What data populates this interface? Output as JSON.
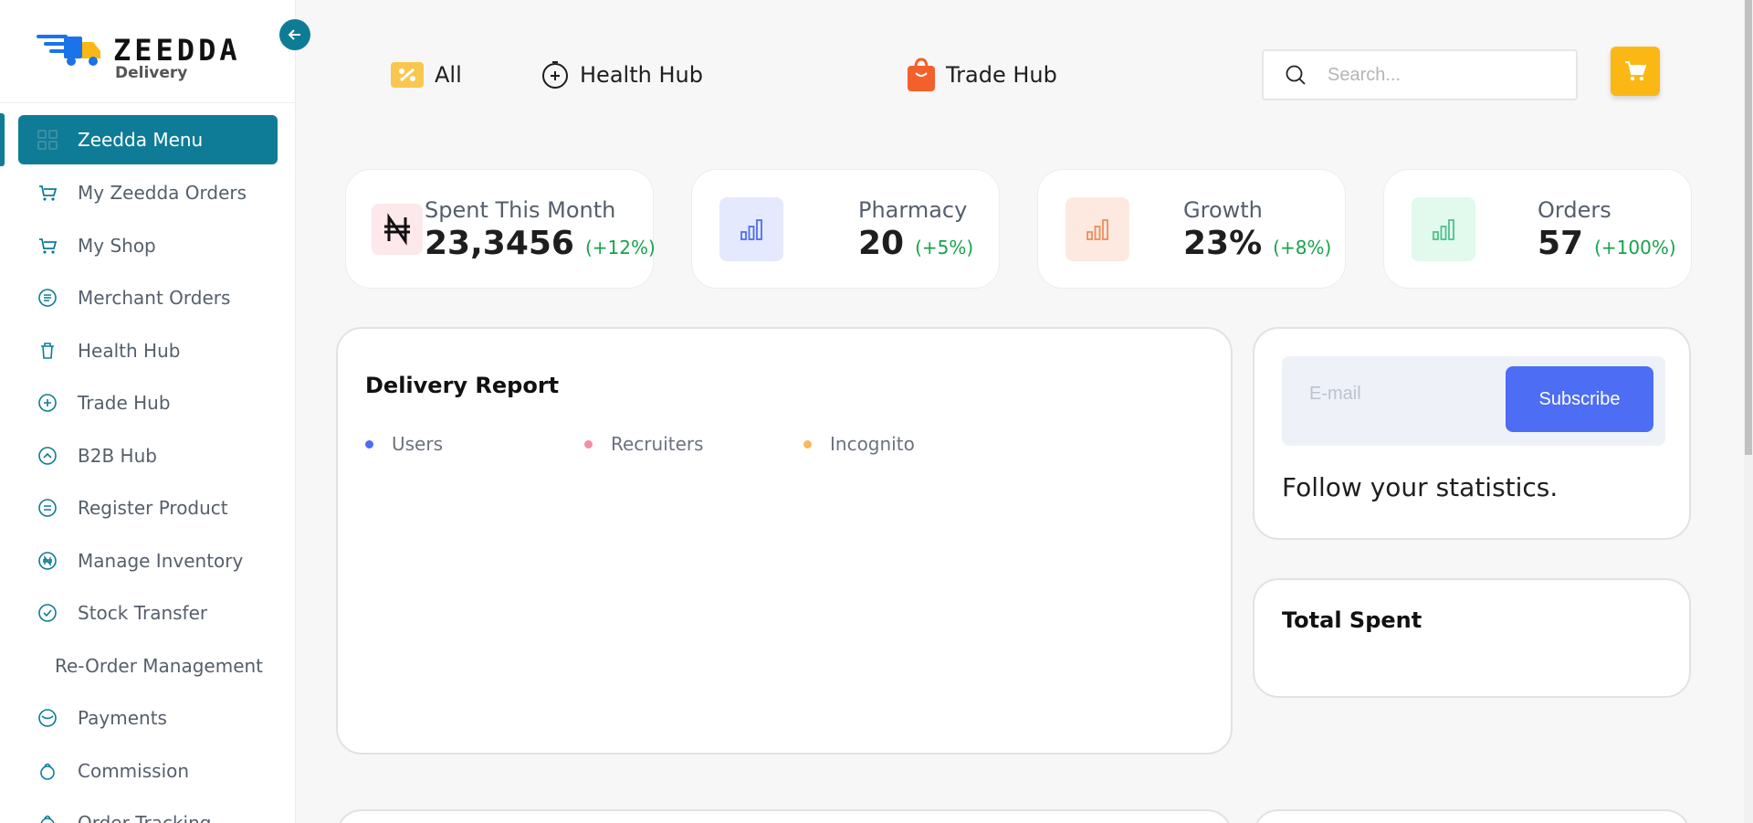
{
  "brand": {
    "name": "ZEEDDA",
    "subtitle": "Delivery"
  },
  "sidebar": {
    "items": [
      {
        "label": "Zeedda Menu",
        "icon": "grid-icon",
        "active": true
      },
      {
        "label": "My Zeedda Orders",
        "icon": "cart-icon"
      },
      {
        "label": "My Shop",
        "icon": "cart-icon"
      },
      {
        "label": "Merchant Orders",
        "icon": "list-circle-icon"
      },
      {
        "label": "Health Hub",
        "icon": "bin-icon"
      },
      {
        "label": "Trade Hub",
        "icon": "plus-circle-icon"
      },
      {
        "label": "B2B Hub",
        "icon": "arrow-up-circle-icon"
      },
      {
        "label": "Register Product",
        "icon": "equals-circle-icon"
      },
      {
        "label": "Manage Inventory",
        "icon": "naira-circle-icon"
      },
      {
        "label": "Stock Transfer",
        "icon": "check-circle-icon"
      },
      {
        "label": "Re-Order Management",
        "icon": ""
      },
      {
        "label": "Payments",
        "icon": "clock-icon"
      },
      {
        "label": "Commission",
        "icon": "bag-icon"
      },
      {
        "label": "Order Tracking",
        "icon": "bag-icon"
      }
    ]
  },
  "topnav": {
    "all": "All",
    "health_hub": "Health Hub",
    "trade_hub": "Trade Hub",
    "search_placeholder": "Search..."
  },
  "stats": [
    {
      "label": "Spent This Month",
      "value": "23,3456",
      "change": "(+12%)",
      "icon": "naira-icon",
      "icon_bg": "#fde8ec"
    },
    {
      "label": "Pharmacy",
      "value": "20",
      "change": "(+5%)",
      "icon": "bar-chart-icon",
      "icon_bg": "#e4e9fd"
    },
    {
      "label": "Growth",
      "value": "23%",
      "change": "(+8%)",
      "icon": "bar-chart-icon",
      "icon_bg": "#fde9df"
    },
    {
      "label": "Orders",
      "value": "57",
      "change": "(+100%)",
      "icon": "bar-chart-icon",
      "icon_bg": "#e2f9ee"
    }
  ],
  "delivery_report": {
    "title": "Delivery Report",
    "legend": [
      {
        "label": "Users",
        "color": "#4d6df4"
      },
      {
        "label": "Recruiters",
        "color": "#f08fa7"
      },
      {
        "label": "Incognito",
        "color": "#f9b85b"
      }
    ]
  },
  "subscribe": {
    "email_placeholder": "E-mail",
    "button": "Subscribe",
    "follow_text": "Follow your statistics."
  },
  "total_spent": {
    "title": "Total Spent"
  },
  "colors": {
    "primary": "#0e7c96",
    "accent": "#fbb714",
    "button_blue": "#4d6df4",
    "positive": "#16a34a"
  }
}
